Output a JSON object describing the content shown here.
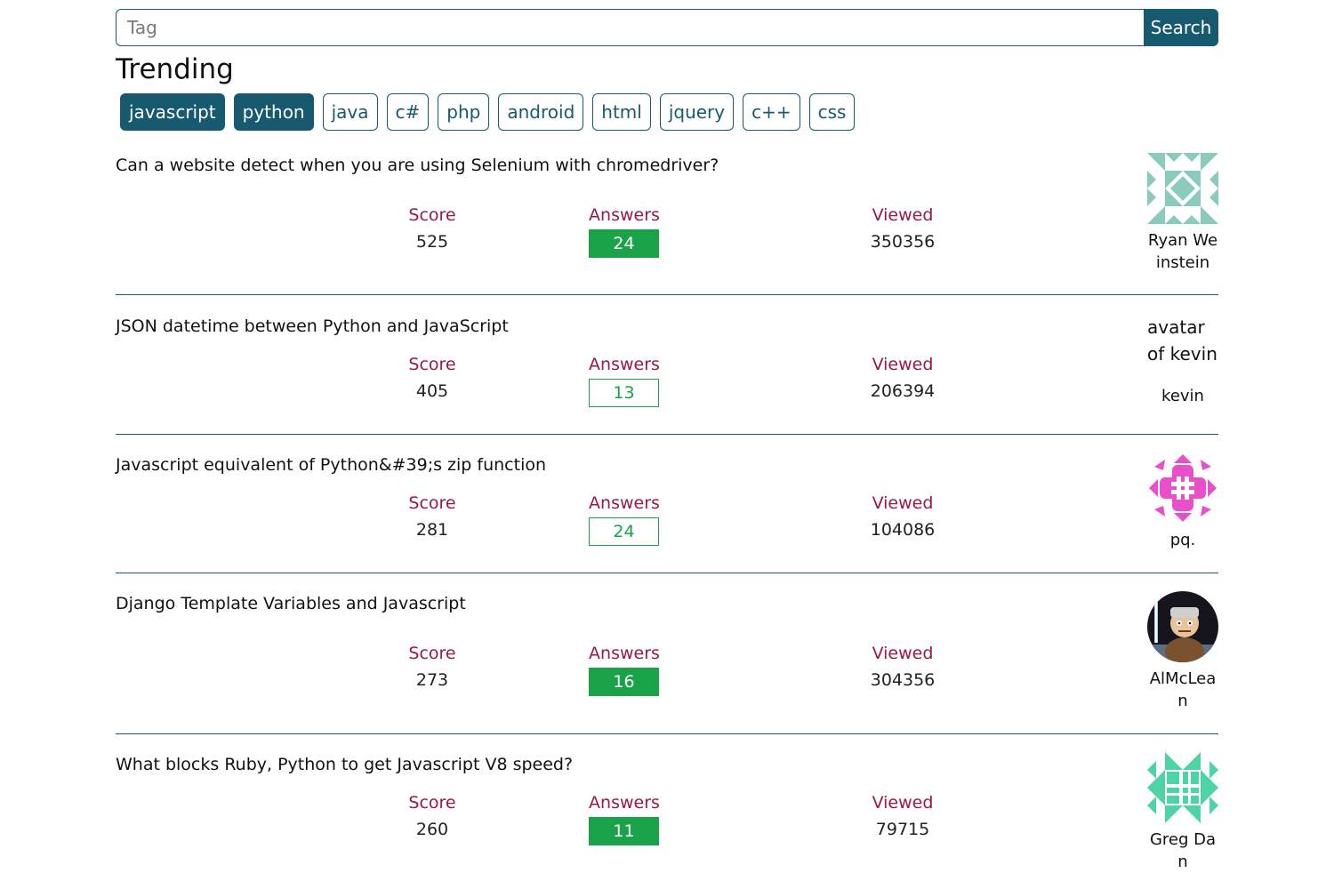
{
  "search": {
    "placeholder": "Tag",
    "button_label": "Search"
  },
  "trending": {
    "title": "Trending",
    "tags": [
      {
        "label": "javascript",
        "active": true
      },
      {
        "label": "python",
        "active": true
      },
      {
        "label": "java",
        "active": false
      },
      {
        "label": "c#",
        "active": false
      },
      {
        "label": "php",
        "active": false
      },
      {
        "label": "android",
        "active": false
      },
      {
        "label": "html",
        "active": false
      },
      {
        "label": "jquery",
        "active": false
      },
      {
        "label": "c++",
        "active": false
      },
      {
        "label": "css",
        "active": false
      }
    ]
  },
  "labels": {
    "score": "Score",
    "answers": "Answers",
    "viewed": "Viewed"
  },
  "colors": {
    "primary": "#17596e",
    "stat_label": "#9b1846",
    "accepted": "#19a248"
  },
  "questions": [
    {
      "title": "Can a website detect when you are using Selenium with chromedriver?",
      "score": "525",
      "answers": "24",
      "accepted": true,
      "views": "350356",
      "author": "Ryan Weinstein",
      "avatar": "identicon-teal"
    },
    {
      "title": "JSON datetime between Python and JavaScript",
      "score": "405",
      "answers": "13",
      "accepted": false,
      "views": "206394",
      "author": "kevin",
      "avatar_alt": "avatar of kevin"
    },
    {
      "title": "Javascript equivalent of Python&#39;s zip function",
      "score": "281",
      "answers": "24",
      "accepted": false,
      "views": "104086",
      "author": "pq.",
      "avatar": "identicon-pink"
    },
    {
      "title": "Django Template Variables and Javascript",
      "score": "273",
      "answers": "16",
      "accepted": true,
      "views": "304356",
      "author": "AlMcLean",
      "avatar": "photo-cartoon-character"
    },
    {
      "title": "What blocks Ruby, Python to get Javascript V8 speed?",
      "score": "260",
      "answers": "11",
      "accepted": true,
      "views": "79715",
      "author": "Greg Dan",
      "avatar": "identicon-green"
    }
  ]
}
